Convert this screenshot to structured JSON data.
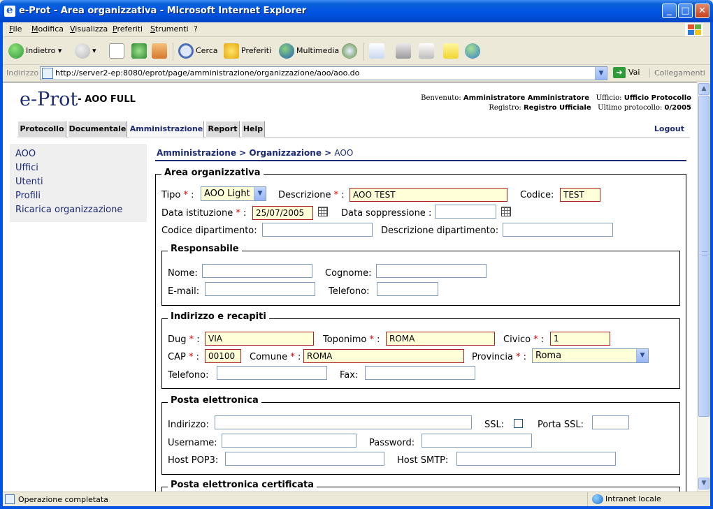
{
  "window": {
    "title": "e-Prot - Area organizzativa - Microsoft Internet Explorer",
    "minimize": "_",
    "maximize": "□",
    "close": "✕"
  },
  "menu": [
    "File",
    "Modifica",
    "Visualizza",
    "Preferiti",
    "Strumenti",
    "?"
  ],
  "toolbar": {
    "back": "Indietro",
    "search": "Cerca",
    "favorites": "Preferiti",
    "media": "Multimedia",
    "icons": [
      "back-icon",
      "forward-icon",
      "stop-icon",
      "refresh-icon",
      "home-icon",
      "search-icon",
      "favorites-star-icon",
      "media-icon",
      "history-icon",
      "mail-icon",
      "print-icon",
      "edit-icon",
      "notes-icon",
      "messenger-icon"
    ]
  },
  "address": {
    "label": "Indirizzo",
    "url": "http://server2-ep:8080/eprot/page/amministrazione/organizzazione/aoo/aoo.do",
    "go": "Vai",
    "links": "Collegamenti"
  },
  "app": {
    "logo": "e-Prot",
    "logo_sub": "- AOO FULL",
    "welcome_label": "Benvenuto:",
    "welcome_user": "Amministratore Amministratore",
    "office_label": "Ufficio:",
    "office_value": "Ufficio Protocollo",
    "register_label": "Registro:",
    "register_value": "Registro Ufficiale",
    "last_protocol_label": "Ultimo protocollo:",
    "last_protocol_value": "0/2005",
    "logout": "Logout"
  },
  "tabs": [
    "Protocollo",
    "Documentale",
    "Amministrazione",
    "Report",
    "Help"
  ],
  "active_tab": "Amministrazione",
  "sidebar": [
    "AOO",
    "Uffici",
    "Utenti",
    "Profili",
    "Ricarica organizzazione"
  ],
  "breadcrumb": {
    "part1": "Amministrazione",
    "sep": ">",
    "part2": "Organizzazione",
    "current": "AOO"
  },
  "area": {
    "legend": "Area organizzativa",
    "tipo_label": "Tipo",
    "tipo_value": "AOO Light",
    "descrizione_label": "Descrizione",
    "descrizione_value": "AOO TEST",
    "codice_label": "Codice",
    "codice_value": "TEST",
    "data_istituzione_label": "Data istituzione",
    "data_istituzione_value": "25/07/2005",
    "data_soppressione_label": "Data soppressione",
    "data_soppressione_value": "",
    "codice_dip_label": "Codice dipartimento",
    "codice_dip_value": "",
    "descrizione_dip_label": "Descrizione dipartimento",
    "descrizione_dip_value": ""
  },
  "responsabile": {
    "legend": "Responsabile",
    "nome_label": "Nome",
    "nome_value": "",
    "cognome_label": "Cognome",
    "cognome_value": "",
    "email_label": "E-mail",
    "email_value": "",
    "telefono_label": "Telefono",
    "telefono_value": ""
  },
  "indirizzo": {
    "legend": "Indirizzo e recapiti",
    "dug_label": "Dug",
    "dug_value": "VIA",
    "toponimo_label": "Toponimo",
    "toponimo_value": "ROMA",
    "civico_label": "Civico",
    "civico_value": "1",
    "cap_label": "CAP",
    "cap_value": "00100",
    "comune_label": "Comune",
    "comune_value": "ROMA",
    "provincia_label": "Provincia",
    "provincia_value": "Roma",
    "telefono_label": "Telefono",
    "telefono_value": "",
    "fax_label": "Fax",
    "fax_value": ""
  },
  "posta": {
    "legend": "Posta elettronica",
    "indirizzo_label": "Indirizzo",
    "indirizzo_value": "",
    "ssl_label": "SSL",
    "porta_ssl_label": "Porta SSL",
    "porta_ssl_value": "",
    "username_label": "Username",
    "username_value": "",
    "password_label": "Password",
    "password_value": "",
    "pop3_label": "Host POP3",
    "pop3_value": "",
    "smtp_label": "Host SMTP",
    "smtp_value": ""
  },
  "pec": {
    "legend": "Posta elettronica certificata"
  },
  "status": {
    "text": "Operazione completata",
    "zone": "Intranet locale"
  },
  "colors": {
    "brand": "#1c2a74",
    "required_bg": "#ffffd8",
    "required_mark": "#dd0000",
    "xp_blue": "#0054e3"
  }
}
